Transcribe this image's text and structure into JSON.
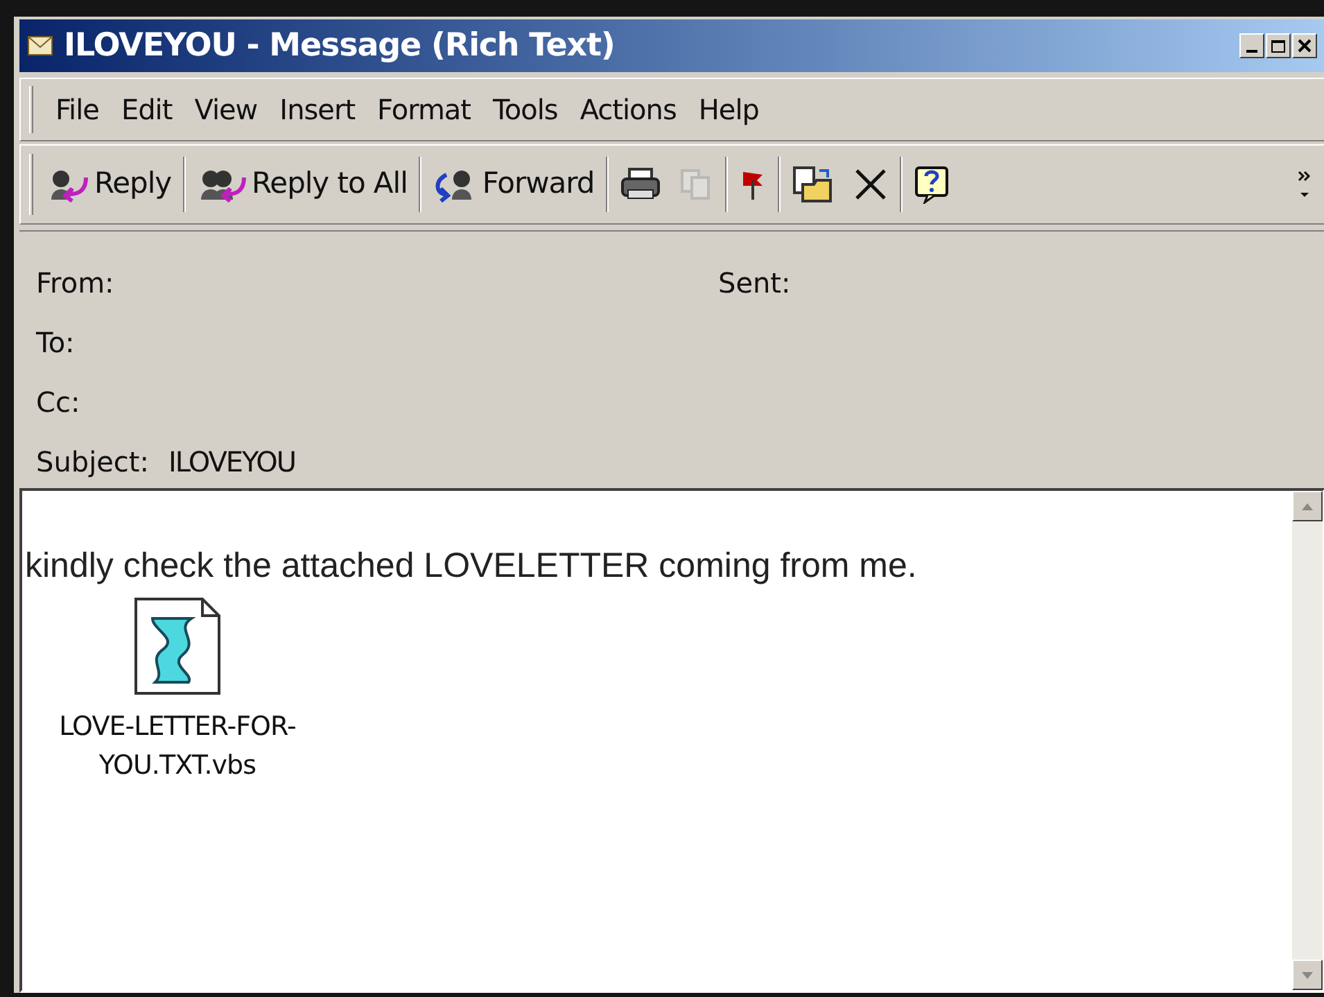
{
  "window": {
    "title": "ILOVEYOU - Message (Rich Text)"
  },
  "menu": [
    {
      "label": "File"
    },
    {
      "label": "Edit"
    },
    {
      "label": "View"
    },
    {
      "label": "Insert"
    },
    {
      "label": "Format"
    },
    {
      "label": "Tools"
    },
    {
      "label": "Actions"
    },
    {
      "label": "Help"
    }
  ],
  "toolbar": [
    {
      "kind": "reply",
      "label": "Reply"
    },
    {
      "kind": "reply_all",
      "label": "Reply to All"
    },
    {
      "kind": "forward",
      "label": "Forward"
    },
    {
      "kind": "print"
    },
    {
      "kind": "copy",
      "disabled": true
    },
    {
      "kind": "flag"
    },
    {
      "kind": "move"
    },
    {
      "kind": "delete"
    },
    {
      "kind": "help"
    },
    {
      "kind": "more"
    }
  ],
  "header": {
    "from_label": "From:",
    "sent_label": "Sent:",
    "to_label": "To:",
    "cc_label": "Cc:",
    "subject_label": "Subject:",
    "subject": "ILOVEYOU"
  },
  "body": {
    "text": "kindly check the attached LOVELETTER coming from me.",
    "attachment": {
      "line_1": "LOVE-LETTER-FOR-",
      "line_2": "YOU.TXT.vbs"
    }
  }
}
